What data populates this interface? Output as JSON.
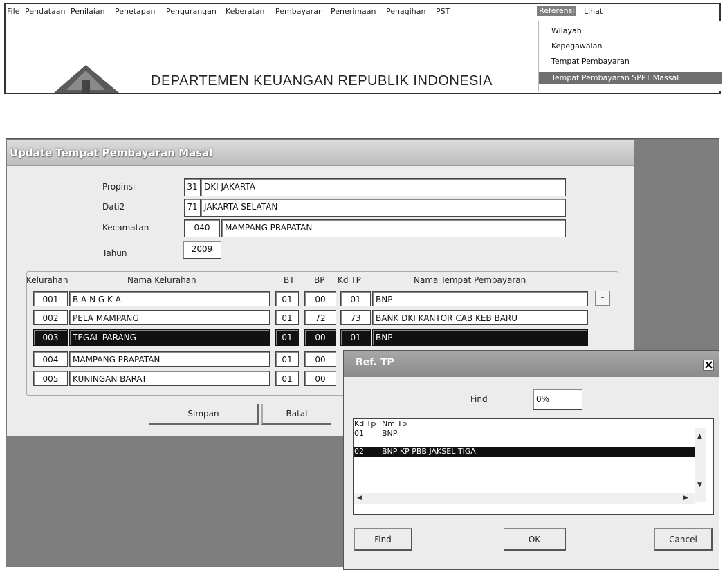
{
  "menubar": {
    "items": [
      "File",
      "Pendataan",
      "Penilaian",
      "Penetapan",
      "Pengurangan",
      "Keberatan",
      "Pembayaran",
      "Penerimaan",
      "Penagihan",
      "PST",
      "Referensi",
      "Lihat"
    ]
  },
  "dropdown": {
    "items": [
      "Wilayah",
      "Kepegawaian",
      "Tempat Pembayaran",
      "Tempat Pembayaran SPPT Massal"
    ]
  },
  "app_title": "DEPARTEMEN KEUANGAN REPUBLIK INDONESIA",
  "form": {
    "title": "Update Tempat Pembayaran Masal",
    "propinsi": {
      "label": "Propinsi",
      "code": "31",
      "name": "DKI JAKARTA"
    },
    "dati2": {
      "label": "Dati2",
      "code": "71",
      "name": "JAKARTA SELATAN"
    },
    "kecamatan": {
      "label": "Kecamatan",
      "code": "040",
      "name": "MAMPANG PRAPATAN"
    },
    "tahun": {
      "label": "Tahun",
      "value": "2009"
    },
    "headers": {
      "kelurahan": "Kelurahan",
      "nama_kelurahan": "Nama Kelurahan",
      "bt": "BT",
      "bp": "BP",
      "kd_tp": "Kd TP",
      "nama_tp": "Nama Tempat Pembayaran"
    },
    "rows": [
      {
        "kode": "001",
        "nama": "B A N G K A",
        "bt": "01",
        "bp": "00",
        "kdtp": "01",
        "nmtp": "BNP"
      },
      {
        "kode": "002",
        "nama": "PELA MAMPANG",
        "bt": "01",
        "bp": "72",
        "kdtp": "73",
        "nmtp": "BANK DKI KANTOR CAB KEB BARU"
      },
      {
        "kode": "003",
        "nama": "TEGAL PARANG",
        "bt": "01",
        "bp": "00",
        "kdtp": "01",
        "nmtp": "BNP"
      },
      {
        "kode": "004",
        "nama": "MAMPANG PRAPATAN",
        "bt": "01",
        "bp": "00"
      },
      {
        "kode": "005",
        "nama": "KUNINGAN BARAT",
        "bt": "01",
        "bp": "00"
      }
    ],
    "scroll_glyph": "–",
    "simpan_label": "Simpan",
    "batal_label": "Batal"
  },
  "dialog": {
    "title": "Ref. TP",
    "close_glyph": "×",
    "find_label": "Find",
    "find_value": "0%",
    "list_headers": {
      "kd": "Kd Tp",
      "nm": "Nm Tp"
    },
    "list_rows": [
      {
        "kd": "01",
        "nm": "BNP"
      },
      {
        "kd": "02",
        "nm": "BNP KP PBB JAKSEL TIGA"
      }
    ],
    "find_button": "Find",
    "ok_button": "OK",
    "cancel_button": "Cancel"
  }
}
